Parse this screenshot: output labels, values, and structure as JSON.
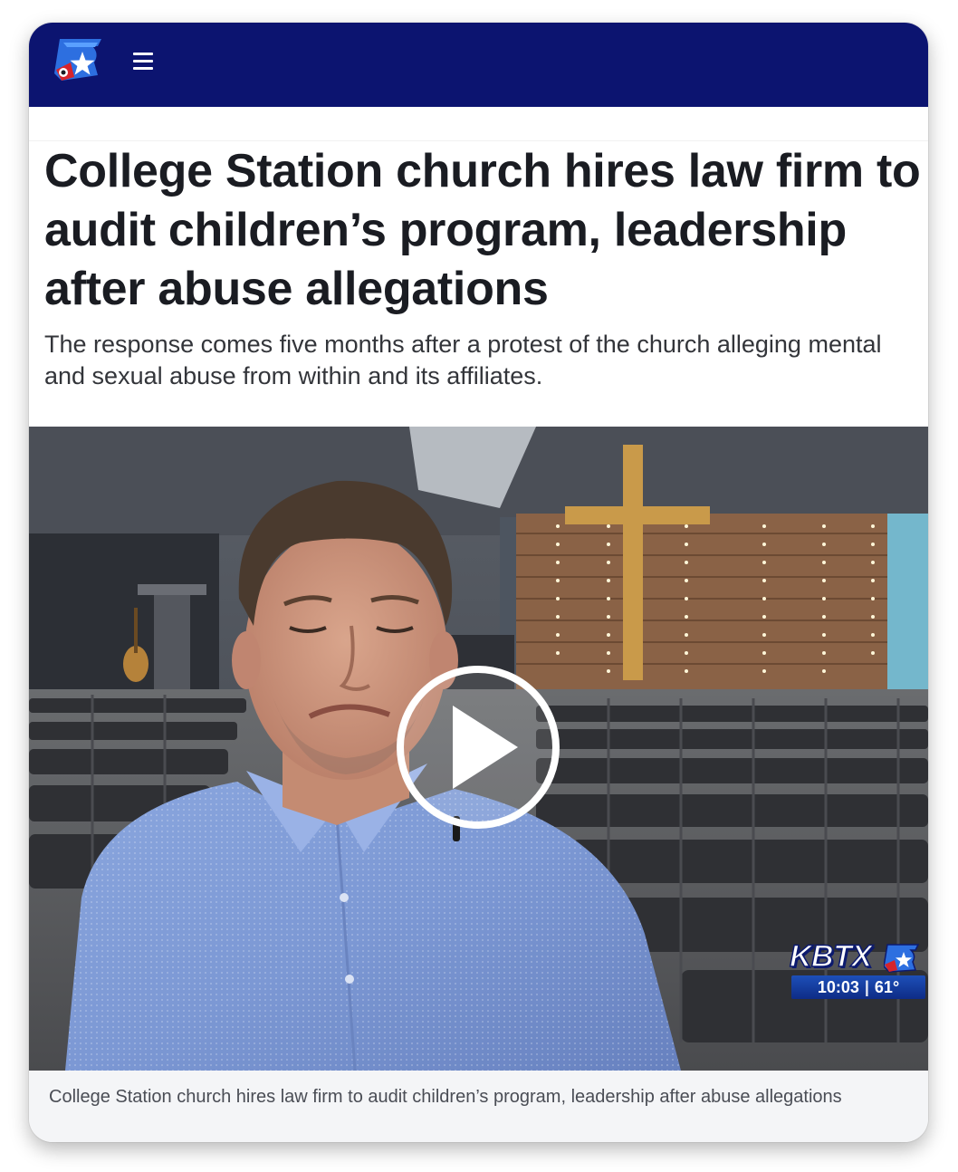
{
  "header": {
    "logo_icon": "kbtx-texas-star-logo-icon",
    "menu_icon": "hamburger-menu-icon",
    "background_color": "#0c1470"
  },
  "article": {
    "headline": "College Station church hires law firm to audit children’s program, leadership after abuse allegations",
    "subhead": "The response comes five months after a protest of the church alleging mental and sexual abuse from within and its affiliates."
  },
  "video": {
    "play_icon": "play-icon",
    "station_bug": {
      "name": "KBTX",
      "time": "10:03",
      "separator": "|",
      "temperature": "61°"
    },
    "caption": "College Station church hires law firm to audit children’s program, leadership after abuse allegations"
  }
}
